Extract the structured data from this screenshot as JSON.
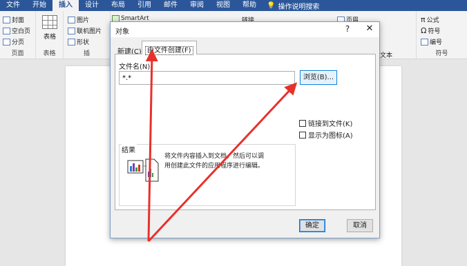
{
  "menubar": {
    "tabs": [
      "文件",
      "开始",
      "插入",
      "设计",
      "布局",
      "引用",
      "邮件",
      "审阅",
      "视图",
      "帮助"
    ],
    "active_tab": "插入",
    "tell_me": "操作说明搜索"
  },
  "ribbon": {
    "pages": {
      "cover": "封面",
      "blank": "空白页",
      "break": "分页",
      "label": "页面"
    },
    "tables": {
      "table": "表格",
      "label": "表格"
    },
    "illustrations": {
      "picture": "图片",
      "online_picture": "联机图片",
      "shapes": "形状",
      "smartart": "SmartArt",
      "label": "插"
    },
    "links": {
      "link": "链接"
    },
    "header": {
      "page_header": "页眉"
    },
    "text": {
      "label": "文本"
    },
    "symbols": {
      "equation": "公式",
      "symbol": "符号",
      "number": "编号",
      "label": "符号"
    }
  },
  "dialog": {
    "title": "对象",
    "help": "?",
    "close": "✕",
    "tabs": {
      "new": "新建(C)",
      "from_file": "由文件创建(F)"
    },
    "filename_label": "文件名(N):",
    "filename_value": "*.*",
    "browse": "浏览(B)...",
    "link_to_file": "链接到文件(K)",
    "display_as_icon": "显示为图标(A)",
    "result_label": "结果",
    "result_text": "将文件内容插入到文档，然后可以调用创建此文件的应用程序进行编辑。",
    "ok": "确定",
    "cancel": "取消"
  },
  "colors": {
    "title_bar": "#2b579a",
    "annotation_arrow": "#e8302a",
    "focus_border": "#0078d7"
  }
}
